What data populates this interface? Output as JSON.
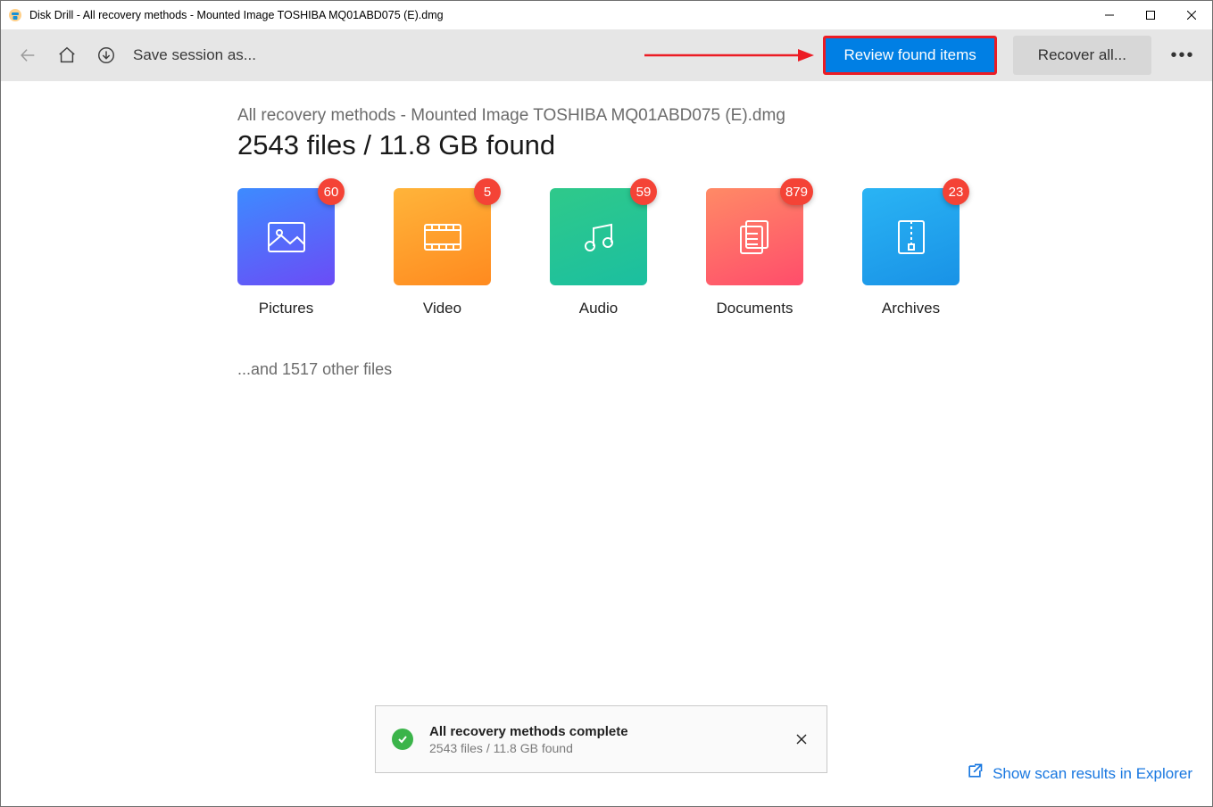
{
  "window": {
    "title": "Disk Drill - All recovery methods - Mounted Image TOSHIBA MQ01ABD075 (E).dmg"
  },
  "toolbar": {
    "save_label": "Save session as...",
    "review_label": "Review found items",
    "recover_label": "Recover all..."
  },
  "main": {
    "subtitle": "All recovery methods - Mounted Image TOSHIBA MQ01ABD075 (E).dmg",
    "headline": "2543 files / 11.8 GB found",
    "other_files": "...and 1517 other files",
    "categories": [
      {
        "key": "pictures",
        "label": "Pictures",
        "count": 60
      },
      {
        "key": "video",
        "label": "Video",
        "count": 5
      },
      {
        "key": "audio",
        "label": "Audio",
        "count": 59
      },
      {
        "key": "documents",
        "label": "Documents",
        "count": 879
      },
      {
        "key": "archives",
        "label": "Archives",
        "count": 23
      }
    ]
  },
  "toast": {
    "title": "All recovery methods complete",
    "subtitle": "2543 files / 11.8 GB found"
  },
  "footer": {
    "explorer_link": "Show scan results in Explorer"
  }
}
